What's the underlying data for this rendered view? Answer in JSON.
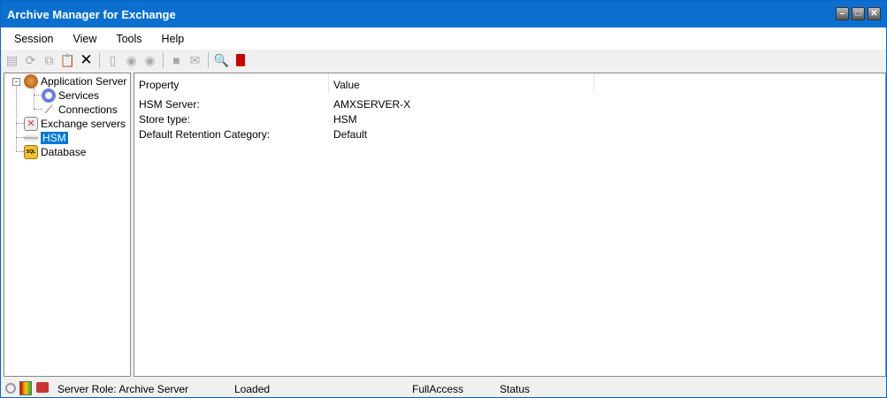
{
  "window": {
    "title": "Archive Manager for Exchange",
    "controls": [
      "minimize",
      "maximize",
      "close"
    ]
  },
  "menu": [
    "Session",
    "View",
    "Tools",
    "Help"
  ],
  "toolbar": [
    "properties-icon",
    "refresh-icon",
    "copy-icon",
    "paste-icon",
    "delete-icon",
    "new-icon",
    "start-icon",
    "stop-icon",
    "save-icon",
    "message-icon",
    "search-icon",
    "book-icon"
  ],
  "tree": {
    "application_server": "Application Server",
    "services": "Services",
    "connections": "Connections",
    "exchange_servers": "Exchange servers",
    "hsm": "HSM",
    "database": "Database"
  },
  "grid": {
    "columns": [
      "Property",
      "Value"
    ],
    "rows": [
      {
        "property": "HSM Server:",
        "value": "AMXSERVER-X"
      },
      {
        "property": "Store type:",
        "value": "HSM"
      },
      {
        "property": "Default Retention Category:",
        "value": "Default"
      }
    ]
  },
  "status": {
    "role": "Server Role: Archive Server",
    "loaded": "Loaded",
    "access": "FullAccess",
    "status": "Status"
  },
  "colors": {
    "titlebar": "#0a6fcf",
    "selection": "#0078d7"
  }
}
